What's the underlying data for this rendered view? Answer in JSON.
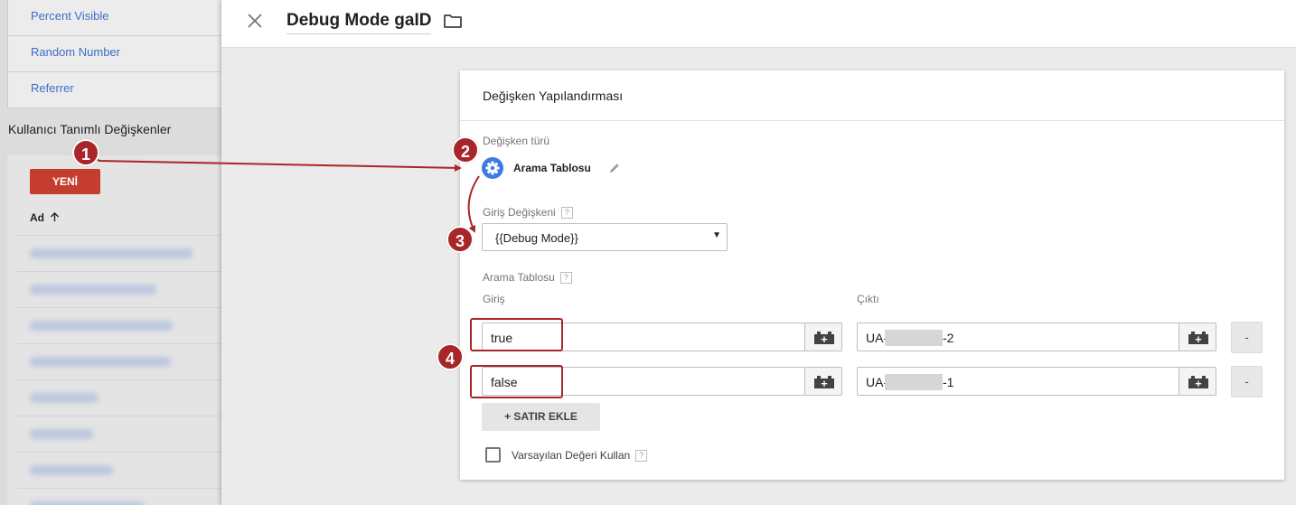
{
  "sidebar": {
    "builtin_items": [
      {
        "label": "Percent Visible"
      },
      {
        "label": "Random Number"
      },
      {
        "label": "Referrer"
      }
    ],
    "user_defined_title": "Kullanıcı Tanımlı Değişkenler",
    "new_button": "YENİ",
    "column_name": "Ad",
    "column_sort_icon": "arrow-up-icon",
    "blurred_rows": 8
  },
  "header": {
    "title": "Debug Mode gaID",
    "close_icon": "close-icon",
    "folder_icon": "folder-icon"
  },
  "config": {
    "title": "Değişken Yapılandırması",
    "type_label": "Değişken türü",
    "type_name": "Arama Tablosu",
    "type_icon": "gear-icon",
    "input_var_label": "Giriş Değişkeni",
    "input_var_value": "{{Debug Mode}}",
    "lookup_label": "Arama Tablosu",
    "col_input": "Giriş",
    "col_output": "Çıktı",
    "rows": [
      {
        "input": "true",
        "output_prefix": "UA-",
        "output_suffix": "-2",
        "remove_label": "-"
      },
      {
        "input": "false",
        "output_prefix": "UA-",
        "output_suffix": "-1",
        "remove_label": "-"
      }
    ],
    "add_row_button": "+ SATIR EKLE",
    "default_checkbox_label": "Varsayılan Değeri Kullan",
    "default_checked": false,
    "help_symbol": "?"
  },
  "annotations": {
    "badges": [
      "1",
      "2",
      "3",
      "4"
    ],
    "color": "#a8262a"
  },
  "colors": {
    "accent_red": "#c53d2f",
    "link_blue": "#3d6ec9",
    "type_icon_blue": "#3e7be0"
  }
}
